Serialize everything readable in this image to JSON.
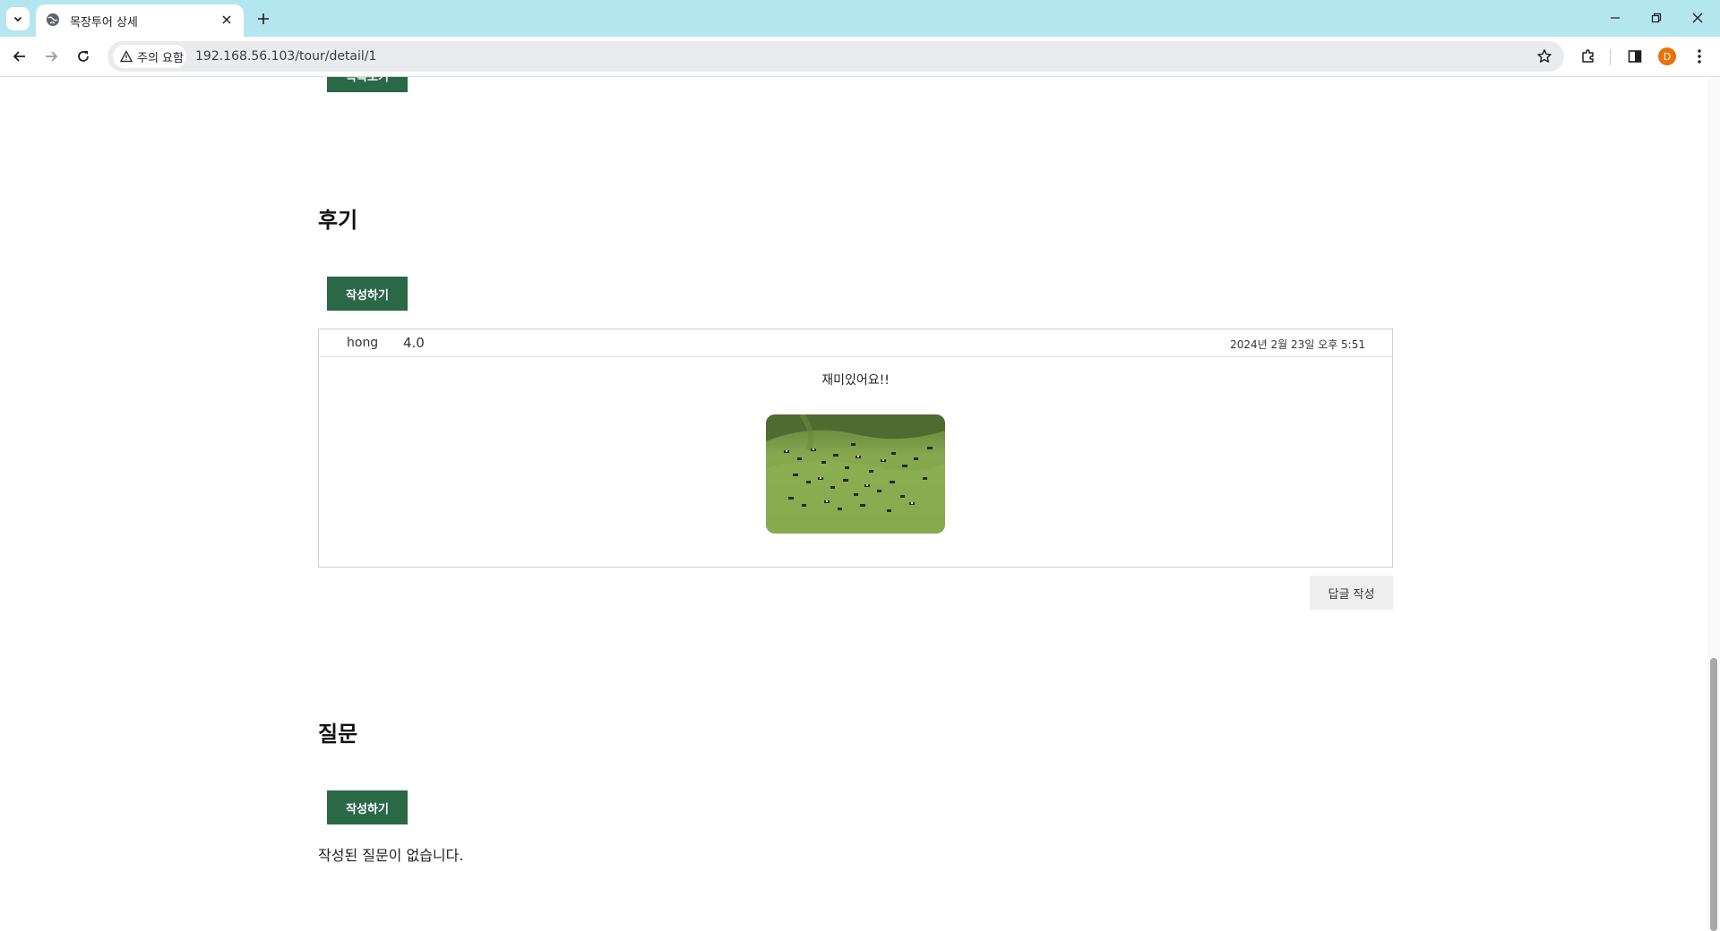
{
  "browser": {
    "tab_title": "목장투어 상세",
    "security_label": "주의 요함",
    "url": "192.168.56.103/tour/detail/1",
    "profile_initial": "D"
  },
  "page": {
    "list_button": "목록보기",
    "reviews": {
      "title": "후기",
      "write_button": "작성하기",
      "items": [
        {
          "author": "hong",
          "rating": "4.0",
          "date": "2024년 2월 23일 오후 5:51",
          "text": "재미있어요!!"
        }
      ],
      "reply_button": "답글 작성"
    },
    "questions": {
      "title": "질문",
      "write_button": "작성하기",
      "empty_message": "작성된 질문이 없습니다."
    }
  },
  "colors": {
    "accent": "#2a6848",
    "tabstrip": "#b4e6f0"
  }
}
